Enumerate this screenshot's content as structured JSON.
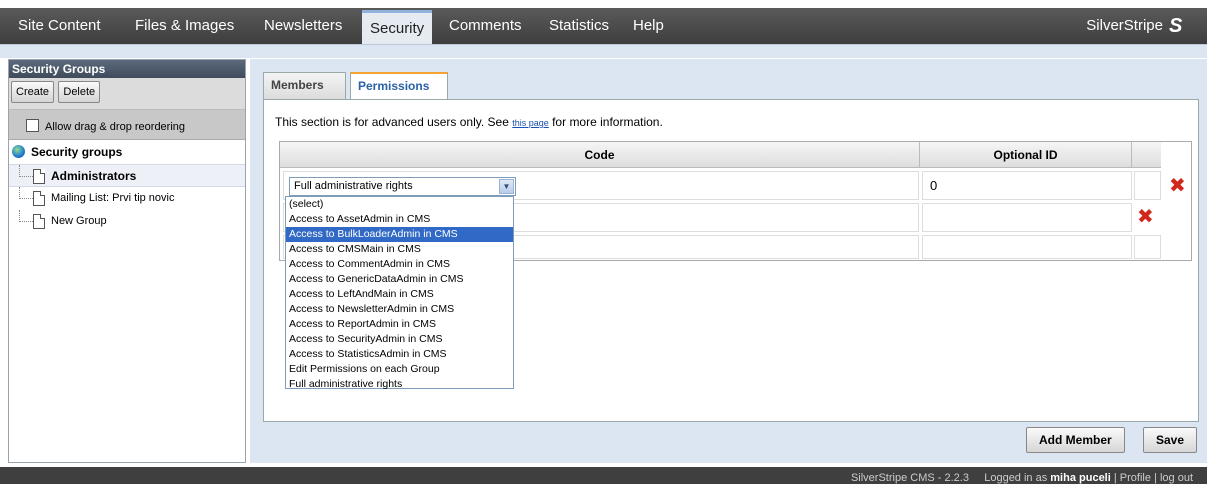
{
  "nav": {
    "items": [
      "Site Content",
      "Files & Images",
      "Newsletters",
      "Security",
      "Comments",
      "Statistics",
      "Help"
    ],
    "active": "Security",
    "brand": "SilverStripe"
  },
  "left": {
    "title": "Security Groups",
    "create_label": "Create",
    "delete_label": "Delete",
    "drag_label": "Allow drag & drop reordering",
    "root_label": "Security groups",
    "groups": [
      "Administrators",
      "Mailing List: Prvi tip novic",
      "New Group"
    ]
  },
  "tabs": [
    "Members",
    "Permissions"
  ],
  "permissions": {
    "note_before": "This section is for advanced users only. See ",
    "note_link": "this page",
    "note_after": " for more information.",
    "col_code": "Code",
    "col_optional_id": "Optional ID",
    "row1_code": "Full administrative rights",
    "row1_optional_id": "0",
    "options": [
      "(select)",
      "Access to AssetAdmin in CMS",
      "Access to BulkLoaderAdmin in CMS",
      "Access to CMSMain in CMS",
      "Access to CommentAdmin in CMS",
      "Access to GenericDataAdmin in CMS",
      "Access to LeftAndMain in CMS",
      "Access to NewsletterAdmin in CMS",
      "Access to ReportAdmin in CMS",
      "Access to SecurityAdmin in CMS",
      "Access to StatisticsAdmin in CMS",
      "Edit Permissions on each Group",
      "Full administrative rights"
    ],
    "highlighted_option": "Access to BulkLoaderAdmin in CMS"
  },
  "buttons": {
    "add_member": "Add Member",
    "save": "Save"
  },
  "footer": {
    "version": "SilverStripe CMS - 2.2.3",
    "logged_in_prefix": "Logged in as",
    "user": "miha puceli",
    "profile": "Profile",
    "logout": "log out"
  },
  "colors": {
    "nav_bg": "#4a4a4a",
    "panel_bg": "#dbe6f2",
    "active_tab_text": "#2a62a8",
    "delete_red": "#d2271b",
    "highlight": "#3169c6"
  }
}
